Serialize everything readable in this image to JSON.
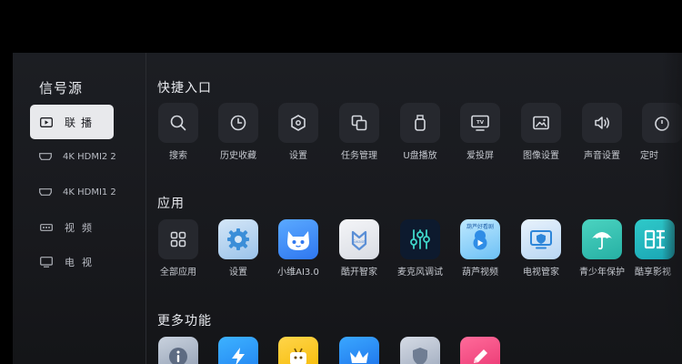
{
  "sidebar": {
    "title": "信号源",
    "items": [
      {
        "label": "联播",
        "icon": "play-source-icon",
        "active": true
      },
      {
        "label": "4K HDMI2 2",
        "icon": "hdmi-icon"
      },
      {
        "label": "4K HDMI1 2",
        "icon": "hdmi-icon"
      },
      {
        "label": "视频",
        "icon": "av-video-icon"
      },
      {
        "label": "电视",
        "icon": "tv-icon"
      }
    ]
  },
  "quick_access": {
    "title": "快捷入口",
    "items": [
      {
        "label": "搜索",
        "icon": "search-icon"
      },
      {
        "label": "历史收藏",
        "icon": "clock-icon"
      },
      {
        "label": "设置",
        "icon": "settings-hex-icon"
      },
      {
        "label": "任务管理",
        "icon": "task-manager-icon"
      },
      {
        "label": "U盘播放",
        "icon": "usb-drive-icon"
      },
      {
        "label": "爱投屏",
        "icon": "tv-cast-icon"
      },
      {
        "label": "图像设置",
        "icon": "picture-icon"
      },
      {
        "label": "声音设置",
        "icon": "speaker-icon"
      },
      {
        "label": "定时",
        "icon": "timer-icon"
      }
    ]
  },
  "apps": {
    "title": "应用",
    "items": [
      {
        "label": "全部应用",
        "icon": "all-apps-grid-icon"
      },
      {
        "label": "设置",
        "icon": "settings-gear-icon"
      },
      {
        "label": "小维AI3.0",
        "icon": "xiaowei-ai-icon"
      },
      {
        "label": "酷开智家",
        "icon": "coocaa-smart-home-icon",
        "watermark": "Swaiot"
      },
      {
        "label": "麦克风调试",
        "icon": "microphone-tuning-icon"
      },
      {
        "label": "葫芦视频",
        "icon": "hulu-video-icon",
        "watermark": "葫芦好看剧"
      },
      {
        "label": "电视管家",
        "icon": "tv-manager-shield-icon"
      },
      {
        "label": "青少年保护",
        "icon": "youth-protection-umbrella-icon"
      },
      {
        "label": "酷享影视",
        "icon": "kuxiang-movies-icon"
      }
    ]
  },
  "more": {
    "title": "更多功能",
    "items": [
      {
        "icon": "info-icon"
      },
      {
        "icon": "lightning-icon"
      },
      {
        "icon": "tv-mascot-icon"
      },
      {
        "icon": "crown-icon"
      },
      {
        "icon": "shield-icon"
      },
      {
        "icon": "pencil-icon"
      }
    ]
  },
  "colors": {
    "active_bg": "#e8e9ec",
    "tile_bg": "#26282e",
    "screen_bg": "#1a1b1f"
  }
}
